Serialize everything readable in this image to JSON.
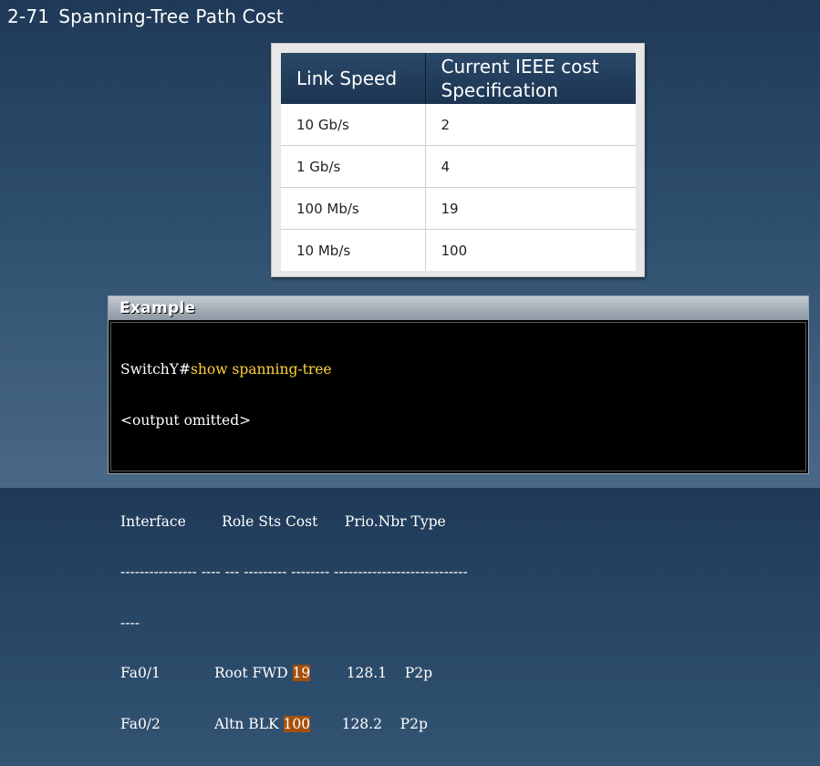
{
  "slide": {
    "number": "2-71",
    "title": "Spanning-Tree Path Cost"
  },
  "cost_table": {
    "headers": [
      "Link Speed",
      "Current IEEE cost Specification"
    ],
    "header_lines": [
      [
        "Link Speed"
      ],
      [
        "Current IEEE cost",
        "Specification"
      ]
    ],
    "rows": [
      {
        "speed": "10 Gb/s",
        "cost": "2"
      },
      {
        "speed": "1 Gb/s",
        "cost": "4"
      },
      {
        "speed": "100 Mb/s",
        "cost": "19"
      },
      {
        "speed": "10 Mb/s",
        "cost": "100"
      }
    ]
  },
  "example": {
    "header": "Example",
    "prompt": "SwitchY#",
    "command": "show spanning-tree",
    "omitted": "<output omitted>",
    "columns_line": "Interface        Role Sts Cost      Prio.Nbr Type",
    "dash_line_1": "---------------- ---- --- --------- -------- ----------------------------",
    "dash_line_2": "----",
    "rows": [
      {
        "prefix": "Fa0/1            Root FWD ",
        "cost": "19",
        "suffix": "        128.1    P2p"
      },
      {
        "prefix": "Fa0/2            Altn BLK ",
        "cost": "100",
        "suffix": "       128.2    P2p"
      }
    ],
    "highlight_color": "#a54f0c",
    "command_color": "#ffd23a"
  }
}
